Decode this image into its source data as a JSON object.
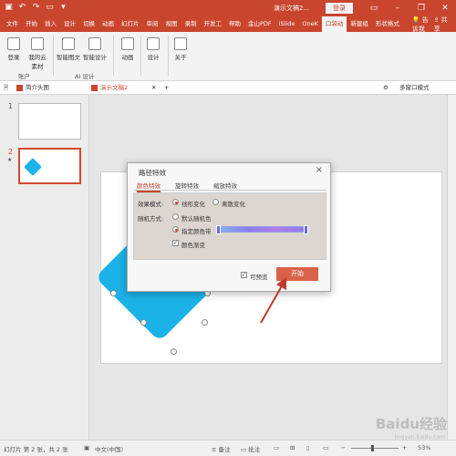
{
  "titlebar": {
    "doc_title": "演示文稿2...",
    "login_label": "登录",
    "icons": [
      "save-icon",
      "undo-icon",
      "redo-icon",
      "present-icon",
      "customize-icon"
    ],
    "window_buttons": [
      "ribbon-display-icon",
      "minimize-icon",
      "restore-icon",
      "close-icon"
    ]
  },
  "tabs": {
    "items": [
      "文件",
      "开始",
      "插入",
      "设计",
      "切换",
      "动画",
      "幻灯片",
      "审阅",
      "视图",
      "录制",
      "开发工",
      "帮助",
      "金山PDF",
      "iSlide",
      "OneK",
      "口袋动",
      "新建组",
      "形状格式"
    ],
    "active_index": 15,
    "tell_me": "告诉我",
    "share": "共享"
  },
  "ribbon": {
    "buttons": [
      {
        "label": "登录"
      },
      {
        "label": "我的云素材"
      },
      {
        "label": "智能图文"
      },
      {
        "label": "智能设计"
      },
      {
        "label": "动画"
      },
      {
        "label": "设计"
      },
      {
        "label": "关于"
      }
    ],
    "groups": [
      "账户",
      "AI 设计"
    ]
  },
  "doctabs": {
    "tab1": "简介头图",
    "tab2": "演示文稿2",
    "add": "+",
    "right_label": "多窗口模式"
  },
  "thumbnails": [
    {
      "number": "1",
      "star": ""
    },
    {
      "number": "2",
      "star": "★"
    }
  ],
  "dialog": {
    "title": "路径特效",
    "close": "×",
    "tabs": [
      "颜色特效",
      "旋转特效",
      "缩放特效"
    ],
    "active_tab": 0,
    "effect_mode_label": "效果模式:",
    "effect_options": [
      "线形变化",
      "离散变化"
    ],
    "random_label": "随机方式:",
    "random_options": [
      "默认随机色",
      "指定颜色带"
    ],
    "gradient_check": "颜色渐变",
    "preview_check": "可预览",
    "start_button": "开始"
  },
  "statusbar": {
    "slide_info": "幻灯片 第 2 张，共 2 张",
    "language": "中文(中国)",
    "notes": "备注",
    "comments": "批注",
    "zoom": "53%"
  },
  "watermark": {
    "text": "Baidu经验",
    "sub": "jingyan.baidu.com"
  },
  "colors": {
    "accent": "#c9452e",
    "shape": "#1bb2e7",
    "start_button": "#d9614a"
  }
}
